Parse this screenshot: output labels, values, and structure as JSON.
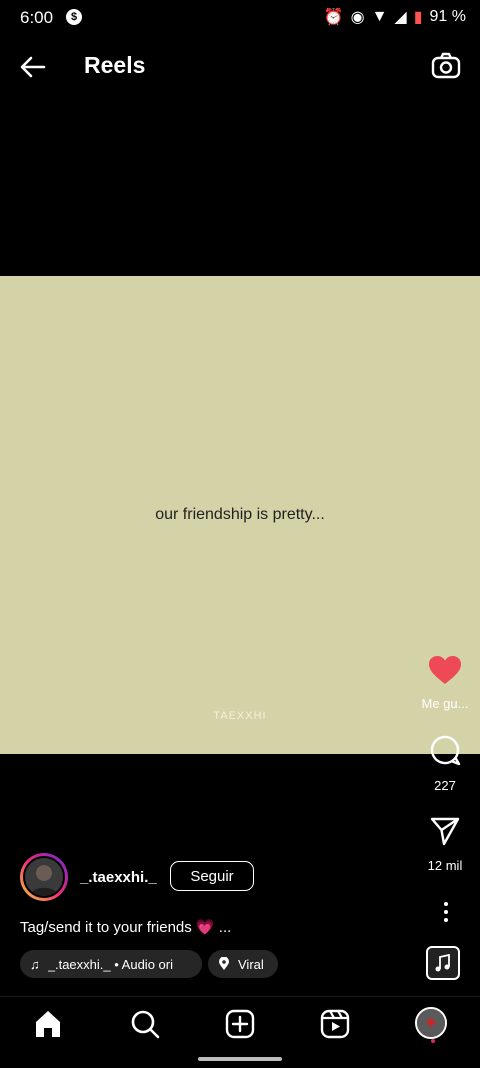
{
  "status_bar": {
    "time": "6:00",
    "battery": "91 %"
  },
  "header": {
    "title": "Reels"
  },
  "reel": {
    "overlay_text": "our friendship is pretty...",
    "watermark": "TAEXXHI",
    "background_color": "#d4d3a8",
    "likes_label": "Me gu...",
    "comments_count": "227",
    "shares_count": "12 mil",
    "author": {
      "username": "_.taexxhi._",
      "follow_label": "Seguir"
    },
    "caption": "Tag/send it to your friends 💗 ...",
    "audio_label": "_.taexxhi._ • Audio ori",
    "location_label": "Viral"
  },
  "icons": {
    "back": "arrow-left-icon",
    "camera": "camera-icon",
    "like": "heart-icon",
    "comment": "comment-icon",
    "share": "send-icon",
    "more": "more-vertical-icon",
    "home": "home-icon",
    "search": "search-icon",
    "create": "add-icon",
    "reels": "reels-icon"
  },
  "colors": {
    "like": "#ed4956",
    "chip_bg": "#262626"
  }
}
